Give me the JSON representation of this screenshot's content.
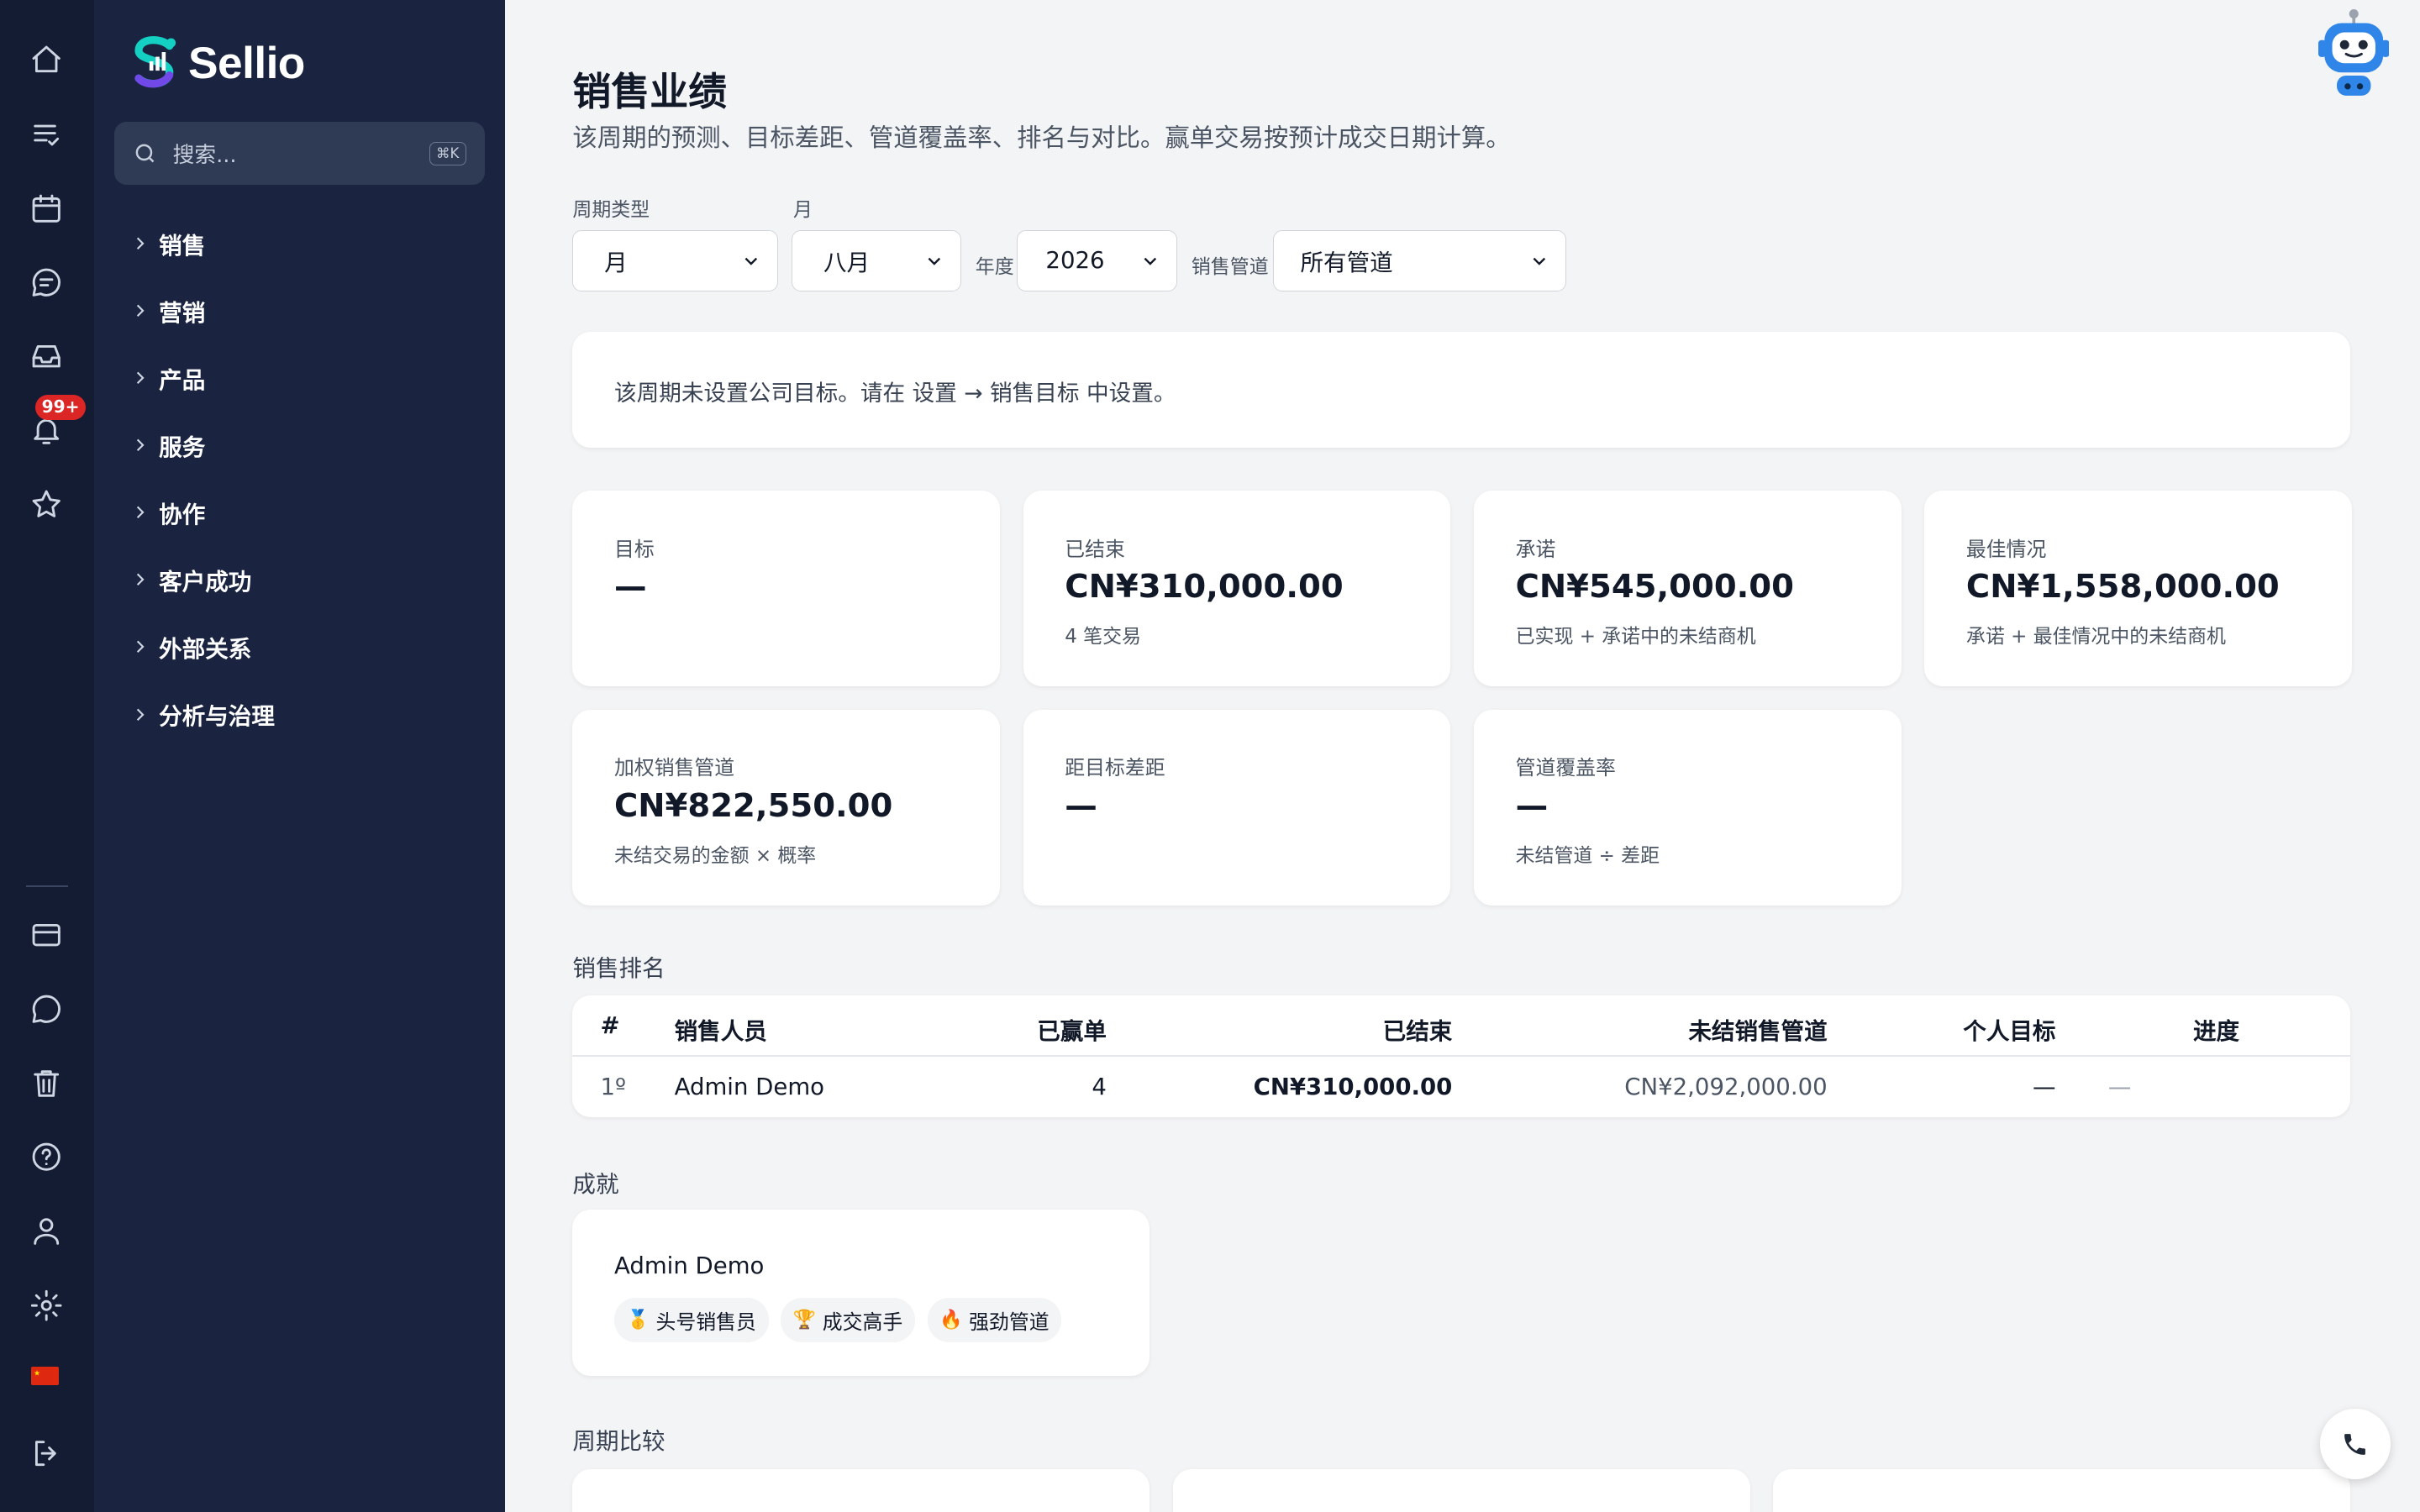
{
  "brand": {
    "name": "Sellio"
  },
  "rail": {
    "notification_badge": "99+"
  },
  "search": {
    "placeholder": "搜索...",
    "shortcut": "⌘K"
  },
  "menu": [
    "销售",
    "营销",
    "产品",
    "服务",
    "协作",
    "客户成功",
    "外部关系",
    "分析与治理"
  ],
  "page": {
    "title": "销售业绩",
    "subtitle": "该周期的预测、目标差距、管道覆盖率、排名与对比。赢单交易按预计成交日期计算。"
  },
  "filters": {
    "period_type_label": "周期类型",
    "period_type_value": "月",
    "month_label": "月",
    "month_value": "八月",
    "year_label": "年度",
    "year_value": "2026",
    "pipeline_label": "销售管道",
    "pipeline_value": "所有管道"
  },
  "notice": "该周期未设置公司目标。请在 设置 → 销售目标 中设置。",
  "kpis": [
    {
      "label": "目标",
      "value": "—",
      "sub": ""
    },
    {
      "label": "已结束",
      "value": "CN¥310,000.00",
      "sub": "4 笔交易"
    },
    {
      "label": "承诺",
      "value": "CN¥545,000.00",
      "sub": "已实现 + 承诺中的未结商机"
    },
    {
      "label": "最佳情况",
      "value": "CN¥1,558,000.00",
      "sub": "承诺 + 最佳情况中的未结商机"
    },
    {
      "label": "加权销售管道",
      "value": "CN¥822,550.00",
      "sub": "未结交易的金额 × 概率"
    },
    {
      "label": "距目标差距",
      "value": "—",
      "sub": ""
    },
    {
      "label": "管道覆盖率",
      "value": "—",
      "sub": "未结管道 ÷ 差距"
    }
  ],
  "ranking": {
    "title": "销售排名",
    "headers": {
      "rank": "#",
      "rep": "销售人员",
      "won": "已赢单",
      "closed": "已结束",
      "open_pipeline": "未结销售管道",
      "personal_target": "个人目标",
      "progress": "进度"
    },
    "rows": [
      {
        "rank": "1º",
        "rep": "Admin Demo",
        "won": "4",
        "closed": "CN¥310,000.00",
        "open_pipeline": "CN¥2,092,000.00",
        "personal_target": "—",
        "progress": "—"
      }
    ]
  },
  "achievements": {
    "title": "成就",
    "user": "Admin Demo",
    "badges": [
      {
        "icon": "medal-icon",
        "glyph": "🥇",
        "label": "头号销售员"
      },
      {
        "icon": "trophy-icon",
        "glyph": "🏆",
        "label": "成交高手"
      },
      {
        "icon": "fire-icon",
        "glyph": "🔥",
        "label": "强劲管道"
      }
    ]
  },
  "comparison": {
    "title": "周期比较"
  },
  "colors": {
    "rail_bg": "#141c33",
    "nav_bg": "#1a2440",
    "page_bg": "#f3f4f6",
    "badge": "#dc2626",
    "logo_teal": "#14d0c3",
    "logo_purple": "#7c3aed",
    "robot_blue": "#2f86e8"
  }
}
